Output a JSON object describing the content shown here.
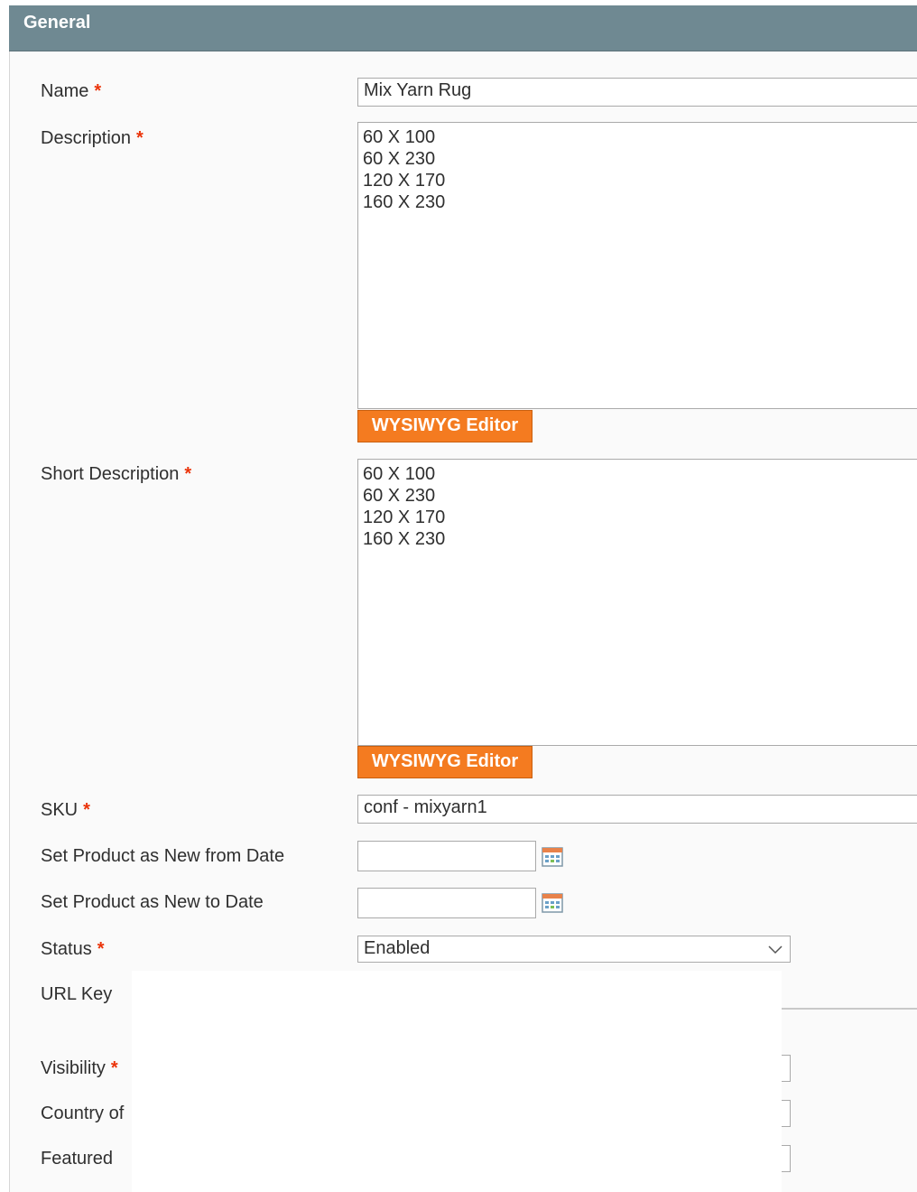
{
  "section": {
    "title": "General"
  },
  "required_mark": "*",
  "fields": {
    "name": {
      "label": "Name",
      "value": "Mix Yarn Rug"
    },
    "description": {
      "label": "Description",
      "lines": [
        "60 X 100",
        "60 X 230",
        "120 X 170",
        "160 X 230"
      ],
      "editor_button": "WYSIWYG Editor"
    },
    "short_description": {
      "label": "Short Description",
      "lines": [
        "60 X 100",
        "60 X 230",
        "120 X 170",
        "160 X 230"
      ],
      "editor_button": "WYSIWYG Editor"
    },
    "sku": {
      "label": "SKU",
      "value": "conf - mixyarn1"
    },
    "new_from_date": {
      "label": "Set Product as New from Date",
      "value": ""
    },
    "new_to_date": {
      "label": "Set Product as New to Date",
      "value": ""
    },
    "status": {
      "label": "Status",
      "value": "Enabled"
    },
    "url_key": {
      "label": "URL Key"
    },
    "visibility": {
      "label": "Visibility"
    },
    "country": {
      "label": "Country of"
    },
    "featured": {
      "label": "Featured"
    }
  },
  "colors": {
    "header": "#6f8992",
    "button": "#f47b20",
    "required": "#eb340a"
  },
  "icons": {
    "calendar": "calendar-icon",
    "dropdown": "chevron-down-icon"
  }
}
